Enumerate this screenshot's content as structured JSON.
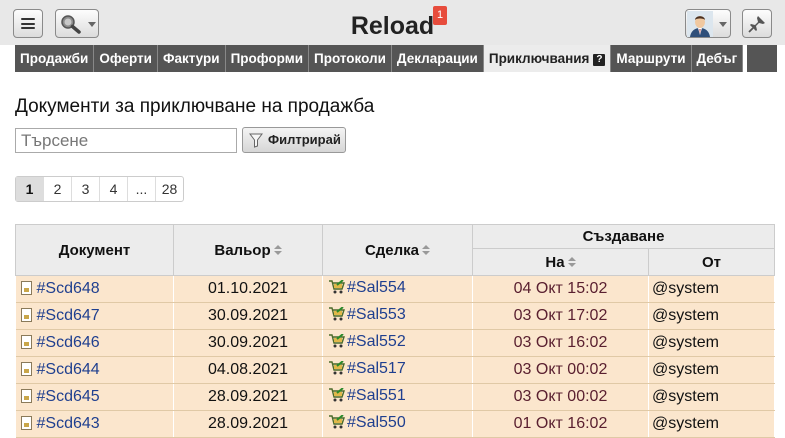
{
  "app": {
    "title": "Reload",
    "notifications": "1"
  },
  "nav": [
    {
      "label": "Продажби",
      "active": false
    },
    {
      "label": "Оферти",
      "active": false
    },
    {
      "label": "Фактури",
      "active": false
    },
    {
      "label": "Проформи",
      "active": false
    },
    {
      "label": "Протоколи",
      "active": false
    },
    {
      "label": "Декларации",
      "active": false
    },
    {
      "label": "Приключвания",
      "active": true,
      "help": "?"
    },
    {
      "label": "Маршрути",
      "active": false
    },
    {
      "label": "Дебъг",
      "active": false
    }
  ],
  "page": {
    "title": "Документи за приключване на продажба",
    "search_placeholder": "Търсене",
    "filter_label": "Филтрирай"
  },
  "pagination": [
    "1",
    "2",
    "3",
    "4",
    "...",
    "28"
  ],
  "table": {
    "headers": {
      "document": "Документ",
      "valor": "Вальор",
      "deal": "Сделка",
      "created": "Създаване",
      "created_on": "На",
      "created_by": "От"
    },
    "rows": [
      {
        "doc": "#Scd648",
        "valor": "01.10.2021",
        "deal": "#Sal554",
        "on": "04 Окт 15:02",
        "by": "@system"
      },
      {
        "doc": "#Scd647",
        "valor": "30.09.2021",
        "deal": "#Sal553",
        "on": "03 Окт 17:02",
        "by": "@system"
      },
      {
        "doc": "#Scd646",
        "valor": "30.09.2021",
        "deal": "#Sal552",
        "on": "03 Окт 16:02",
        "by": "@system"
      },
      {
        "doc": "#Scd644",
        "valor": "04.08.2021",
        "deal": "#Sal517",
        "on": "03 Окт 00:02",
        "by": "@system"
      },
      {
        "doc": "#Scd645",
        "valor": "28.09.2021",
        "deal": "#Sal551",
        "on": "03 Окт 00:02",
        "by": "@system"
      },
      {
        "doc": "#Scd643",
        "valor": "28.09.2021",
        "deal": "#Sal550",
        "on": "01 Окт 16:02",
        "by": "@system"
      }
    ]
  },
  "colors": {
    "row_bg": "#fbe6cd",
    "nav_bg": "#555555",
    "link": "#1f3f8f",
    "badge": "#e74c3c"
  },
  "icons": [
    "menu-icon",
    "search-icon",
    "user-avatar",
    "pin-icon",
    "filter-icon",
    "document-icon",
    "cart-icon"
  ]
}
